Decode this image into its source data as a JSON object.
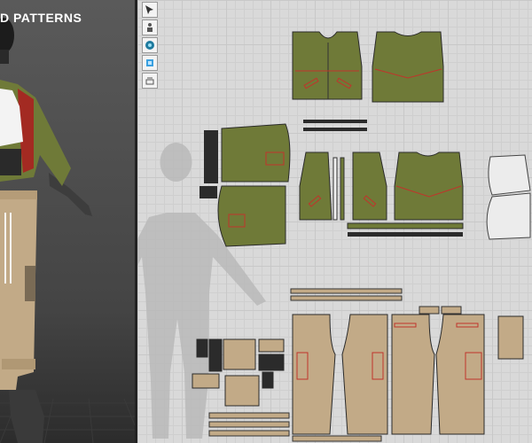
{
  "viewport3d": {
    "title": "D PATTERNS"
  },
  "toolbar2d": {
    "tools": [
      {
        "icon": "pattern-select-icon"
      },
      {
        "icon": "avatar-toggle-icon"
      },
      {
        "icon": "fabric-icon"
      },
      {
        "icon": "layer-icon"
      },
      {
        "icon": "sewing-icon"
      }
    ]
  },
  "colors": {
    "jacket_fabric": "#6f7a38",
    "pants_fabric": "#c2aa87",
    "lining": "#ececec",
    "seam_red": "#c0342b",
    "grid_bg": "#d9d9d9"
  }
}
